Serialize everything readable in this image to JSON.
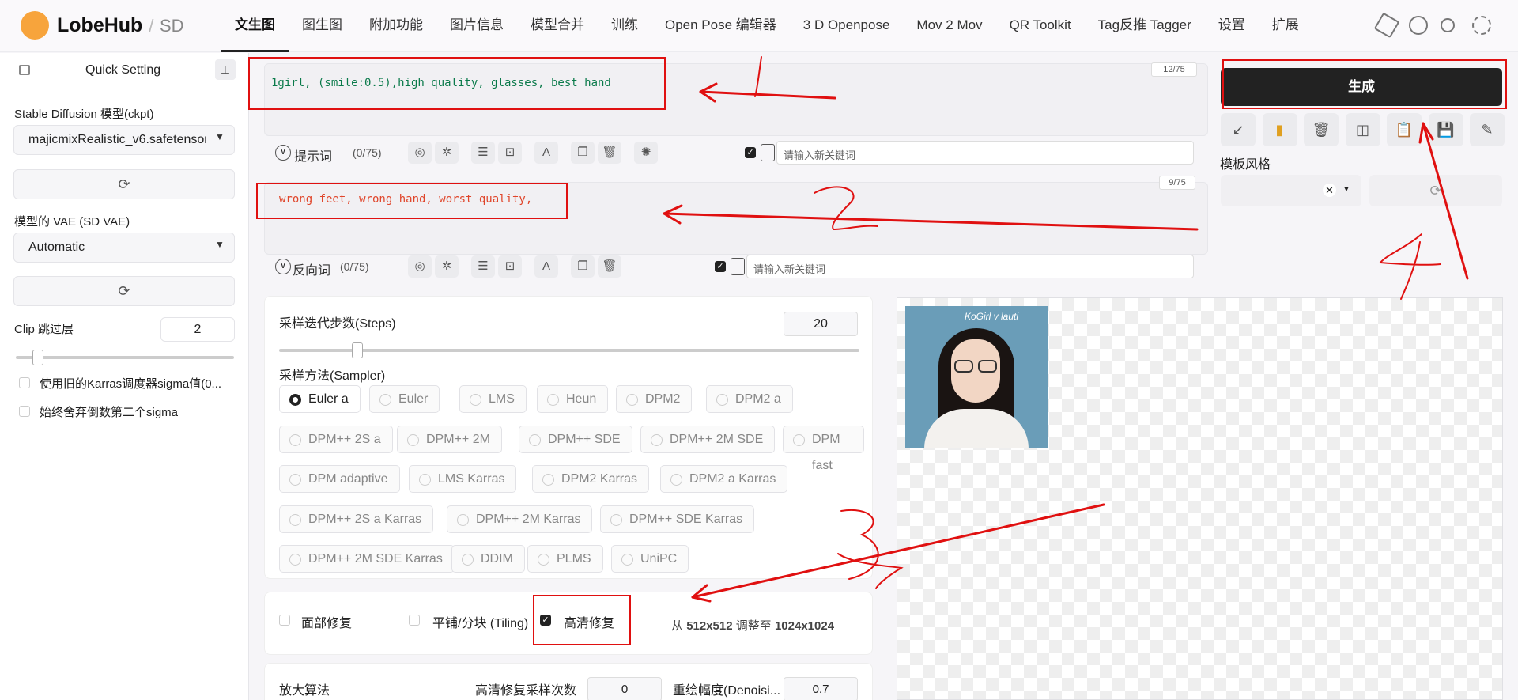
{
  "app": {
    "brand": "LobeHub",
    "separator": "/",
    "sub": "SD"
  },
  "nav": {
    "tabs": [
      "文生图",
      "图生图",
      "附加功能",
      "图片信息",
      "模型合并",
      "训练",
      "Open Pose 编辑器",
      "3 D Openpose",
      "Mov 2 Mov",
      "QR Toolkit",
      "Tag反推 Tagger",
      "设置",
      "扩展"
    ],
    "active": "文生图"
  },
  "topicons": [
    "hexagon-icon",
    "github-icon",
    "sun-icon",
    "settings-gear-icon"
  ],
  "sidebar": {
    "title": "Quick Setting",
    "ckpt_label": "Stable Diffusion 模型(ckpt)",
    "ckpt_value": "majicmixRealistic_v6.safetensors",
    "vae_label": "模型的 VAE (SD VAE)",
    "vae_value": "Automatic",
    "clip_label": "Clip 跳过层",
    "clip_value": "2",
    "clip_slider_fraction": 0.1,
    "opt1": "使用旧的Karras调度器sigma值(0...",
    "opt2": "始终舍弃倒数第二个sigma"
  },
  "prompt": {
    "positive_text": "1girl, (smile:0.5),high quality, glasses, best hand",
    "positive_count": "12/75",
    "positive_label": "提示词",
    "positive_tokens": "(0/75)",
    "keyword_placeholder": "请输入新关键词",
    "negative_text": "wrong feet, wrong hand, worst quality,",
    "negative_count": "9/75",
    "negative_label": "反向词",
    "negative_tokens": "(0/75)"
  },
  "steps": {
    "label": "采样迭代步数(Steps)",
    "value": "20",
    "fraction": 0.135
  },
  "sampler": {
    "label": "采样方法(Sampler)",
    "options": [
      "Euler a",
      "Euler",
      "LMS",
      "Heun",
      "DPM2",
      "DPM2 a",
      "DPM++ 2S a",
      "DPM++ 2M",
      "DPM++ SDE",
      "DPM++ 2M SDE",
      "DPM fast",
      "DPM adaptive",
      "LMS Karras",
      "DPM2 Karras",
      "DPM2 a Karras",
      "DPM++ 2S a Karras",
      "DPM++ 2M Karras",
      "DPM++ SDE Karras",
      "DPM++ 2M SDE Karras",
      "DDIM",
      "PLMS",
      "UniPC"
    ],
    "selected": "Euler a"
  },
  "options": {
    "face_fix": "面部修复",
    "tiling": "平铺/分块 (Tiling)",
    "hires": "高清修复",
    "resize_from": "从",
    "resize_from_value": "512x512",
    "resize_to": "调整至",
    "resize_to_value": "1024x1024"
  },
  "hires": {
    "upscaler_label": "放大算法",
    "steps_label": "高清修复采样次数",
    "steps_value": "0",
    "denoise_label": "重绘幅度(Denoisi...",
    "denoise_value": "0.7"
  },
  "generate": {
    "label": "生成"
  },
  "style": {
    "label": "模板风格"
  },
  "toolbar_icons": [
    "arrow-down-left-icon",
    "card-icon",
    "trash-icon",
    "columns-icon",
    "clipboard-icon",
    "save-icon",
    "magic-wand-icon"
  ],
  "annotations": {
    "color": "#e01010",
    "numbers": [
      "1",
      "2",
      "3",
      "4"
    ]
  },
  "image": {
    "watermark": "KoGirl v lauti"
  }
}
